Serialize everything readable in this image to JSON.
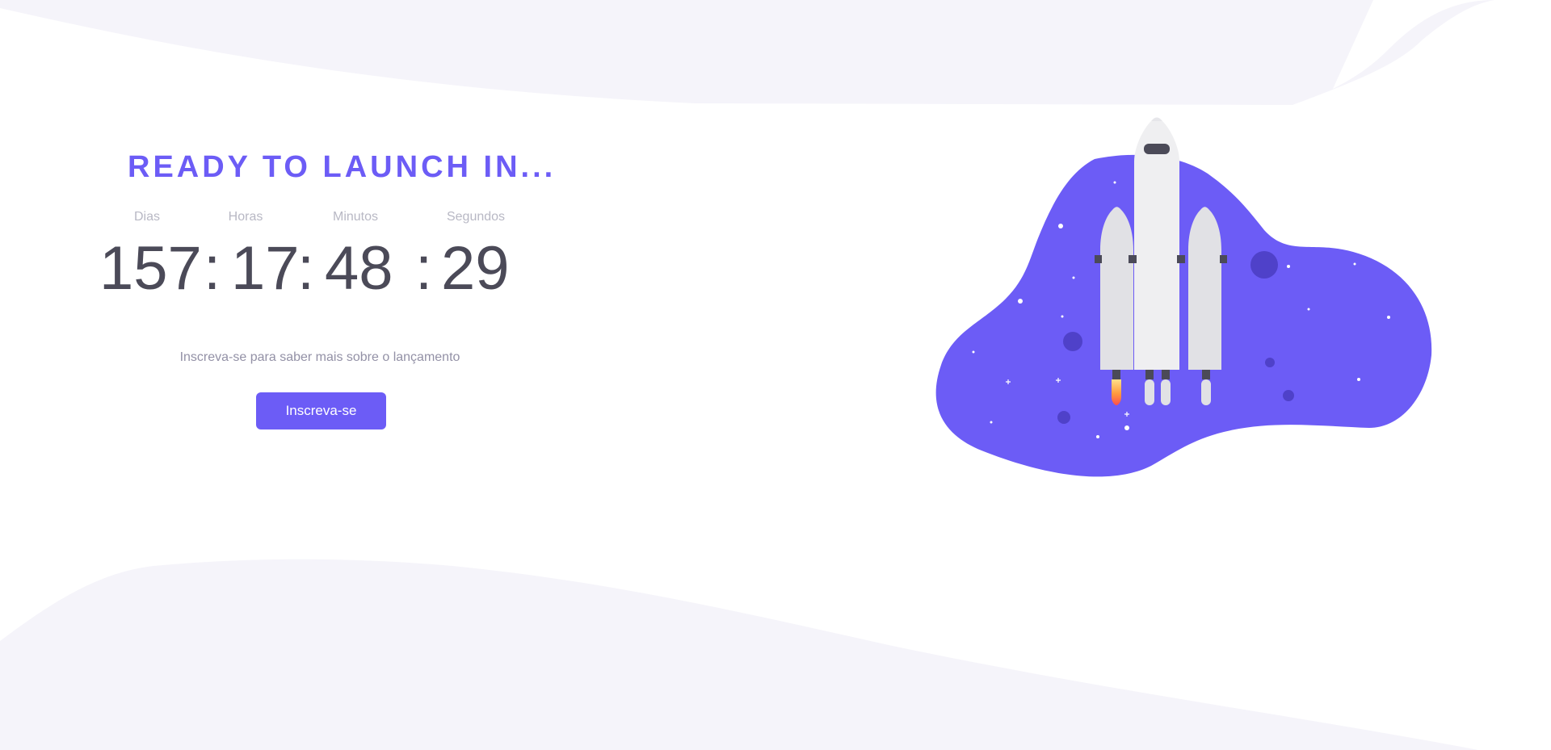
{
  "hero": {
    "title": "READY TO LAUNCH IN...",
    "countdown": {
      "labels": {
        "days": "Dias",
        "hours": "Horas",
        "minutes": "Minutos",
        "seconds": "Segundos"
      },
      "values": {
        "days": "157",
        "hours": "17",
        "minutes": "48",
        "seconds": "29"
      },
      "separator": ":"
    },
    "subtitle": "Inscreva-se para saber mais sobre o lançamento",
    "cta_label": "Inscreva-se"
  },
  "colors": {
    "accent": "#6c5cf6",
    "text_dark": "#4b4a58",
    "text_muted": "#9391a6",
    "wave_bg": "#f5f4fa"
  },
  "illustration": {
    "icon": "rocket-illustration"
  }
}
